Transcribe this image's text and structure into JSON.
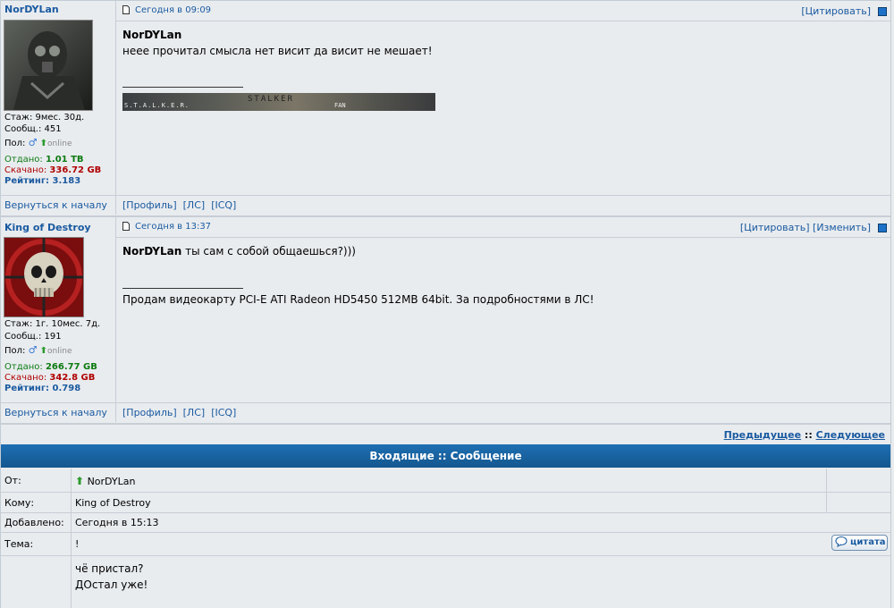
{
  "posts": [
    {
      "username": "NorDYLan",
      "stats": {
        "experience": "Стаж: 9мес. 30д.",
        "messages": "Сообщ.: 451",
        "gender_label": "Пол:",
        "status": "online",
        "uploaded_label": "Отдано:",
        "uploaded_value": "1.01 TB",
        "downloaded_label": "Скачано:",
        "downloaded_value": "336.72 GB",
        "rating_label": "Рейтинг:",
        "rating_value": "3.183"
      },
      "date": "Сегодня в 09:09",
      "actions": [
        "[Цитировать]"
      ],
      "author_bold": "NorDYLan",
      "text": "неее прочитал смысла нет висит да висит не мешает!",
      "signature_banner": {
        "left": "S.T.A.L.K.E.R.",
        "center": "STALKER",
        "right": "FAN"
      },
      "back": "Вернуться к началу",
      "links": [
        "[Профиль]",
        "[ЛС]",
        "[ICQ]"
      ]
    },
    {
      "username": "King of Destroy",
      "stats": {
        "experience": "Стаж: 1г. 10мес. 7д.",
        "messages": "Сообщ.: 191",
        "gender_label": "Пол:",
        "status": "online",
        "uploaded_label": "Отдано:",
        "uploaded_value": "266.77 GB",
        "downloaded_label": "Скачано:",
        "downloaded_value": "342.8 GB",
        "rating_label": "Рейтинг:",
        "rating_value": "0.798"
      },
      "date": "Сегодня в 13:37",
      "actions": [
        "[Цитировать]",
        "[Изменить]"
      ],
      "quoted_name": "NorDYLan",
      "text": "ты сам с собой общаешься?)))",
      "signature": "Продам видеокарту PCI-E ATI Radeon HD5450 512MB 64bit. За подробностями в ЛС!",
      "back": "Вернуться к началу",
      "links": [
        "[Профиль]",
        "[ЛС]",
        "[ICQ]"
      ]
    }
  ],
  "nav": {
    "prev": "Предыдущее",
    "sep": "::",
    "next": "Следующее"
  },
  "message": {
    "header": "Входящие :: Сообщение",
    "from_label": "От:",
    "from_value": "NorDYLan",
    "to_label": "Кому:",
    "to_value": "King of Destroy",
    "added_label": "Добавлено:",
    "added_value": "Сегодня в 15:13",
    "subject_label": "Тема:",
    "subject_value": "!",
    "quote_button": "цитата",
    "body_line1": "чё пристал?",
    "body_line2": "ДОстал уже!"
  },
  "colors": {
    "link": "#1a5aa0",
    "header_bg": "#1e6fb3",
    "upload": "#0b7a10",
    "download": "#b00000"
  }
}
